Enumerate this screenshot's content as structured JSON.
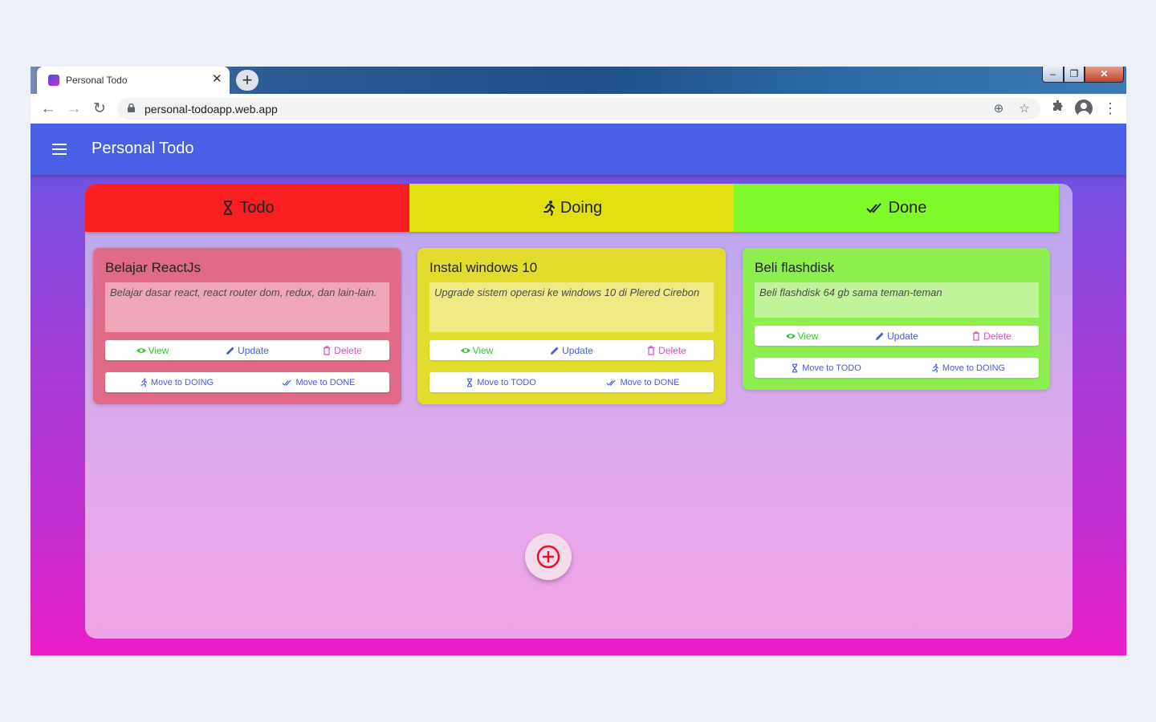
{
  "browser": {
    "tab_title": "Personal Todo",
    "tab_close": "✕",
    "new_tab": "+",
    "url": "personal-todoapp.web.app"
  },
  "app": {
    "title": "Personal Todo"
  },
  "columns": {
    "todo": "Todo",
    "doing": "Doing",
    "done": "Done"
  },
  "cards": [
    {
      "title": "Belajar ReactJs",
      "description": "Belajar dasar react, react router dom, redux, dan lain-lain.",
      "actions": {
        "view": "View",
        "update": "Update",
        "delete": "Delete"
      },
      "moves": [
        "Move to DOING",
        "Move to DONE"
      ]
    },
    {
      "title": "Instal windows 10",
      "description": "Upgrade sistem operasi ke windows 10 di Plered Cirebon",
      "actions": {
        "view": "View",
        "update": "Update",
        "delete": "Delete"
      },
      "moves": [
        "Move to TODO",
        "Move to DONE"
      ]
    },
    {
      "title": "Beli flashdisk",
      "description": "Beli flashdisk 64 gb sama teman-teman",
      "actions": {
        "view": "View",
        "update": "Update",
        "delete": "Delete"
      },
      "moves": [
        "Move to TODO",
        "Move to DOING"
      ]
    }
  ],
  "colors": {
    "appbar": "#485fe6",
    "todo": "#f81e22",
    "doing": "#e2e00e",
    "done": "#7ff929",
    "view": "#33c52b",
    "update": "#4a5be0",
    "delete": "#e54ab9",
    "fab_icon": "#e8102d"
  }
}
